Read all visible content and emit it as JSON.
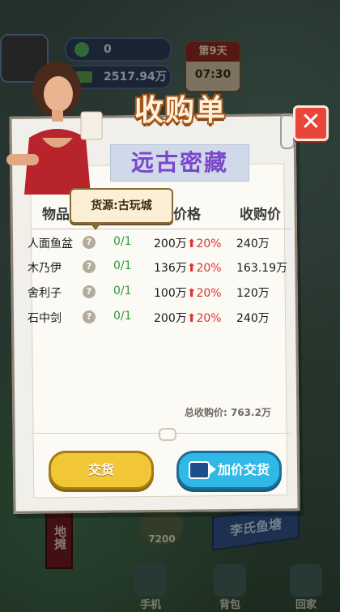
{
  "hud": {
    "gems": "0",
    "money": "2517.94万",
    "day": "第9天",
    "time": "07:30"
  },
  "modal": {
    "title": "收购单",
    "subtitle": "远古密藏",
    "close_icon": "close-x-icon",
    "tooltip": "货源:古玩城",
    "headers": {
      "item": "物品",
      "price": "价格",
      "buy_price": "收购价"
    },
    "rows": [
      {
        "name": "人面鱼盆",
        "count": "0/1",
        "price": "200万",
        "pct": "20%",
        "buy": "240万"
      },
      {
        "name": "木乃伊",
        "count": "0/1",
        "price": "136万",
        "pct": "20%",
        "buy": "163.19万"
      },
      {
        "name": "舍利子",
        "count": "0/1",
        "price": "100万",
        "pct": "20%",
        "buy": "120万"
      },
      {
        "name": "石中剑",
        "count": "0/1",
        "price": "200万",
        "pct": "20%",
        "buy": "240万"
      }
    ],
    "total": "总收购价: 763.2万",
    "deliver_label": "交货",
    "raise_label": "加价交货"
  },
  "background": {
    "market_sign": "地摊",
    "fish_sign": "李氏鱼塘",
    "cash_count": "7200",
    "nav": {
      "phone": "手机",
      "bag": "背包",
      "home": "回家"
    }
  },
  "colors": {
    "title_stroke": "#a85a1e",
    "subtitle": "#7a47c9",
    "count_green": "#2c9a3d",
    "up_red": "#e0322b",
    "deliver_yellow": "#f1c737",
    "raise_blue": "#30b9e6",
    "close_red": "#e8463b"
  }
}
